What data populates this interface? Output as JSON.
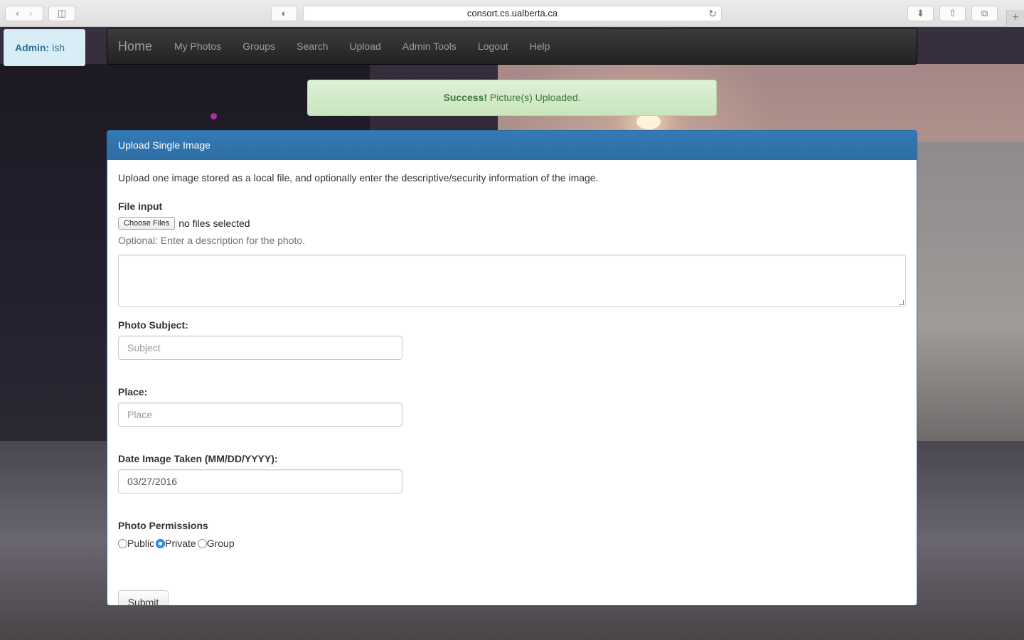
{
  "browser": {
    "url": "consort.cs.ualberta.ca"
  },
  "admin": {
    "prefix": "Admin:",
    "user": "ish"
  },
  "nav": {
    "brand": "Home",
    "links": [
      "My Photos",
      "Groups",
      "Search",
      "Upload",
      "Admin Tools",
      "Logout",
      "Help"
    ]
  },
  "alert": {
    "strong": "Success!",
    "message": "Picture(s) Uploaded."
  },
  "panel": {
    "title": "Upload Single Image",
    "intro": "Upload one image stored as a local file, and optionally enter the descriptive/security information of the image.",
    "file_label": "File input",
    "file_button": "Choose Files",
    "file_status": "no files selected",
    "description_help": "Optional: Enter a description for the photo.",
    "description_value": "",
    "subject_label": "Photo Subject:",
    "subject_placeholder": "Subject",
    "place_label": "Place:",
    "place_placeholder": "Place",
    "date_label": "Date Image Taken (MM/DD/YYYY):",
    "date_value": "03/27/2016",
    "permissions_label": "Photo Permissions",
    "permissions": [
      {
        "label": "Public",
        "checked": false
      },
      {
        "label": "Private",
        "checked": true
      },
      {
        "label": "Group",
        "checked": false
      }
    ],
    "submit": "Submit"
  },
  "colors": {
    "panel_heading": "#337ab7",
    "alert_text": "#3c763d",
    "admin_text": "#31708f",
    "navbar": "#222222"
  }
}
